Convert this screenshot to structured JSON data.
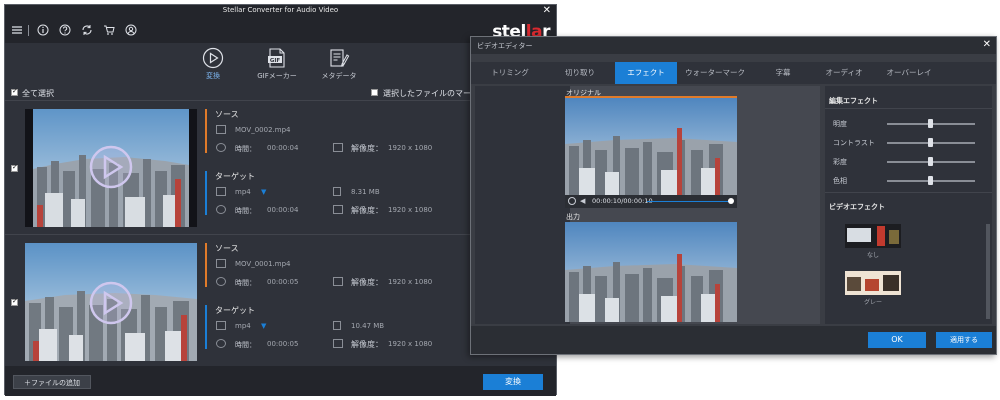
{
  "app": {
    "title": "Stellar Converter for Audio Video",
    "close": "✕",
    "logo": {
      "prefix": "stel",
      "accent": "la",
      "suffix": "r"
    }
  },
  "menu": [
    {
      "icon": "hamburger-menu-icon"
    },
    {
      "icon": "info-icon"
    },
    {
      "icon": "help-icon"
    },
    {
      "icon": "refresh-icon"
    },
    {
      "icon": "cart-icon"
    },
    {
      "icon": "user-icon"
    }
  ],
  "modes": [
    {
      "label": "変換",
      "icon": "play-circle-icon",
      "active": true
    },
    {
      "label": "GIFメーカー",
      "icon": "gif-icon",
      "badge": "GIF",
      "active": false
    },
    {
      "label": "メタデータ",
      "icon": "metadata-edit-icon",
      "active": false
    }
  ],
  "select_all": "全て選択",
  "merge_label": "選択したファイルのマージ",
  "files": [
    {
      "source_title": "ソース",
      "source_file": "MOV_0002.mp4",
      "time_label": "時間：",
      "source_time": "00:00:04",
      "res_label": "解像度：",
      "source_res": "1920 x 1080",
      "target_title": "ターゲット",
      "format": "mp4",
      "size": "8.31 MB",
      "target_time": "00:00:04",
      "target_res": "1920 x 1080"
    },
    {
      "source_title": "ソース",
      "source_file": "MOV_0001.mp4",
      "time_label": "時間：",
      "source_time": "00:00:05",
      "res_label": "解像度：",
      "source_res": "1920 x 1080",
      "target_title": "ターゲット",
      "format": "mp4",
      "size": "10.47 MB",
      "target_time": "00:00:05",
      "target_res": "1920 x 1080"
    }
  ],
  "footer": {
    "add": "＋ファイルの追加",
    "convert": "変換"
  },
  "editor": {
    "title": "ビデオエディター",
    "close": "✕",
    "tabs": [
      "トリミング",
      "切り取り",
      "エフェクト",
      "ウォーターマーク",
      "字幕",
      "オーディオ",
      "オーバーレイ"
    ],
    "active_tab": 2,
    "original_label": "オリジナル",
    "output_label": "出力",
    "timecode": "00:00:10/00:00:10",
    "edit_effects_title": "編集エフェクト",
    "sliders": [
      {
        "label": "明度",
        "value": 0.5
      },
      {
        "label": "コントラスト",
        "value": 0.5
      },
      {
        "label": "彩度",
        "value": 0.5
      },
      {
        "label": "色相",
        "value": 0.5
      }
    ],
    "video_effects_title": "ビデオエフェクト",
    "effects": [
      {
        "label": "なし"
      },
      {
        "label": "グレー"
      }
    ],
    "ok": "OK",
    "apply": "適用する"
  },
  "colors": {
    "accent_blue": "#1b7fd6",
    "source_bar": "#e07b2a",
    "target_bar": "#1b7fd6",
    "window_bg": "#2f323a",
    "titlebar_bg": "#23252b",
    "logo_red": "#d8292f"
  }
}
